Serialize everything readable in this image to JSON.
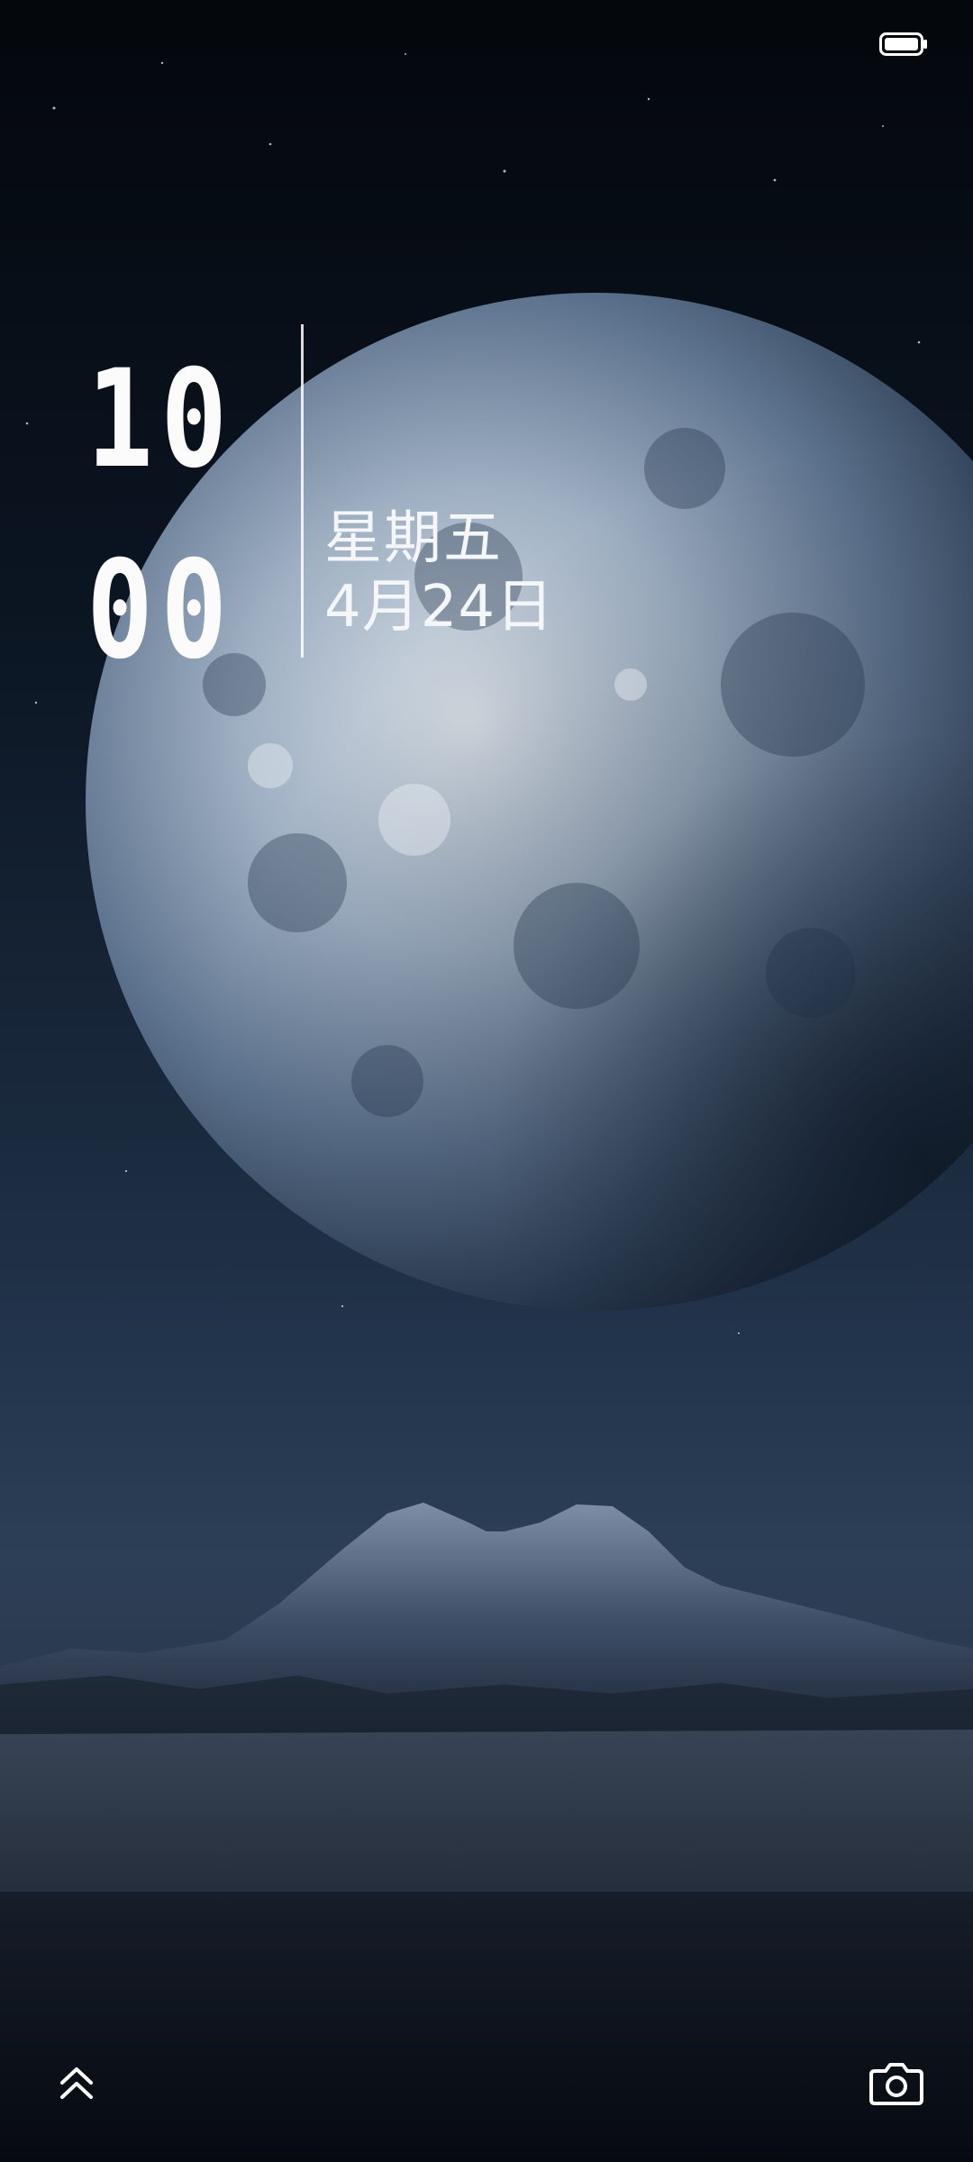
{
  "status_bar": {
    "battery_icon": "battery-full-icon"
  },
  "clock": {
    "hour": "10",
    "minute": "00"
  },
  "date": {
    "weekday": "星期五",
    "date": "4月24日"
  },
  "bottom": {
    "left_icon": "chevron-double-up-icon",
    "right_icon": "camera-icon"
  },
  "colors": {
    "sky_top": "#05080e",
    "sky_mid": "#1b2b40",
    "ground": "#2b3544",
    "text": "#f5f6f8"
  }
}
